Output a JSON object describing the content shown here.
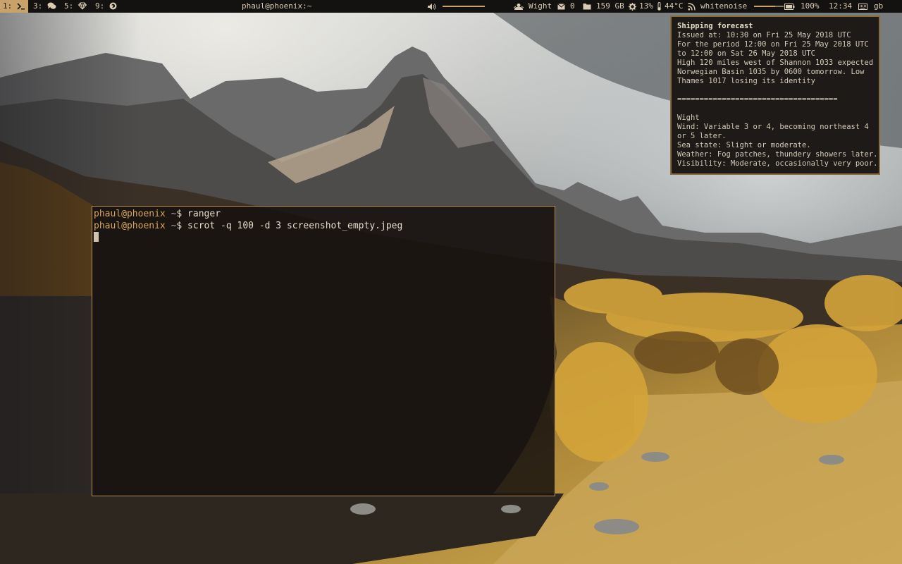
{
  "workspaces": [
    {
      "label": "1:",
      "icon": "terminal-icon",
      "active": true
    },
    {
      "label": "3:",
      "icon": "chat-icon",
      "active": false
    },
    {
      "label": "5:",
      "icon": "gem-icon",
      "active": false
    },
    {
      "label": "9:",
      "icon": "firefox-icon",
      "active": false
    }
  ],
  "window_title": "phaul@phoenix:~",
  "status": {
    "volume_level": 1.0,
    "weather_location": "Wight",
    "mail_count": "0",
    "disk_free": "159 GB",
    "cpu": "13%",
    "temperature": "44°C",
    "sound_name": "whitenoise",
    "sound_level": 0.7,
    "battery": "100%",
    "time": "12:34",
    "keyboard_layout": "gb"
  },
  "terminal": {
    "lines": [
      {
        "user": "phaul@phoenix",
        "tilde": " ~",
        "cmd": "$ ranger"
      },
      {
        "user": "phaul@phoenix",
        "tilde": " ~",
        "cmd": "$ scrot -q 100 -d 3 screenshot_empty.jpeg"
      }
    ]
  },
  "notification": {
    "title": "Shipping forecast",
    "lines": [
      "Issued at: 10:30 on Fri 25 May 2018 UTC",
      "For the period 12:00 on Fri 25 May 2018 UTC",
      "to 12:00 on Sat 26 May 2018 UTC",
      "High 120 miles west of Shannon 1033 expected",
      "Norwegian Basin 1035 by 0600 tomorrow. Low",
      "Thames 1017 losing its identity",
      "",
      "====================================",
      "",
      "Wight",
      "Wind: Variable 3 or 4, becoming northeast 4",
      "or 5 later.",
      "Sea state: Slight or moderate.",
      "Weather: Fog patches, thundery showers later.",
      "Visibility: Moderate, occasionally very poor."
    ]
  },
  "colors": {
    "accent": "#c8a269",
    "bar_bg": "#141211",
    "prompt_user": "#d7a45a",
    "terminal_border": "#b8904f"
  }
}
